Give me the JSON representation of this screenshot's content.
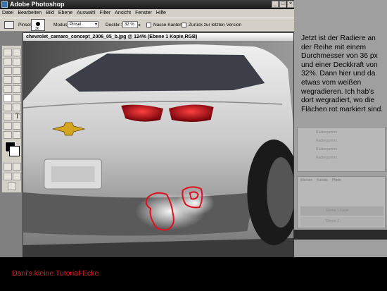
{
  "window": {
    "title": "Adobe Photoshop",
    "buttons": [
      "_",
      "□",
      "×"
    ]
  },
  "menu": [
    "Datei",
    "Bearbeiten",
    "Bild",
    "Ebene",
    "Auswahl",
    "Filter",
    "Ansicht",
    "Fenster",
    "Hilfe"
  ],
  "options": {
    "brush_label": "Pinsel:",
    "brush_size": "36",
    "mode_label": "Modus:",
    "mode_value": "Pinsel",
    "opacity_label": "Deckkr.:",
    "opacity_value": "32 %",
    "wet_edges_label": "Nasse Kanten",
    "erase_to_history_label": "Zurück zur letzten Version"
  },
  "document": {
    "title": "chevrolet_camaro_concept_2006_05_b.jpg @ 124% (Ebene 1 Kopie,RGB)"
  },
  "palettes": {
    "history_items": [
      "Radiergummi",
      "Radiergummi",
      "Radiergummi",
      "Radiergummi"
    ],
    "layers_tabs": [
      "Ebenen",
      "Kanäle",
      "Pfade"
    ],
    "layer_names": [
      "Ebene 1 Kopie",
      "Ebene 1"
    ]
  },
  "tutorial": {
    "text": "Jetzt ist der Radiere an der Reihe mit einem Durchmesser von 36 px und einer Deckkraft von 32%. Dann hier und da etwas vom weißen wegradieren. Ich hab's dort wegradiert, wo die Flächen rot markiert sind.",
    "caption": "Dani's kleine Tutorial-Ecke",
    "caption_color": "#d42020"
  },
  "colors": {
    "marker": "#e0101e",
    "tail_light": "#c01018"
  }
}
